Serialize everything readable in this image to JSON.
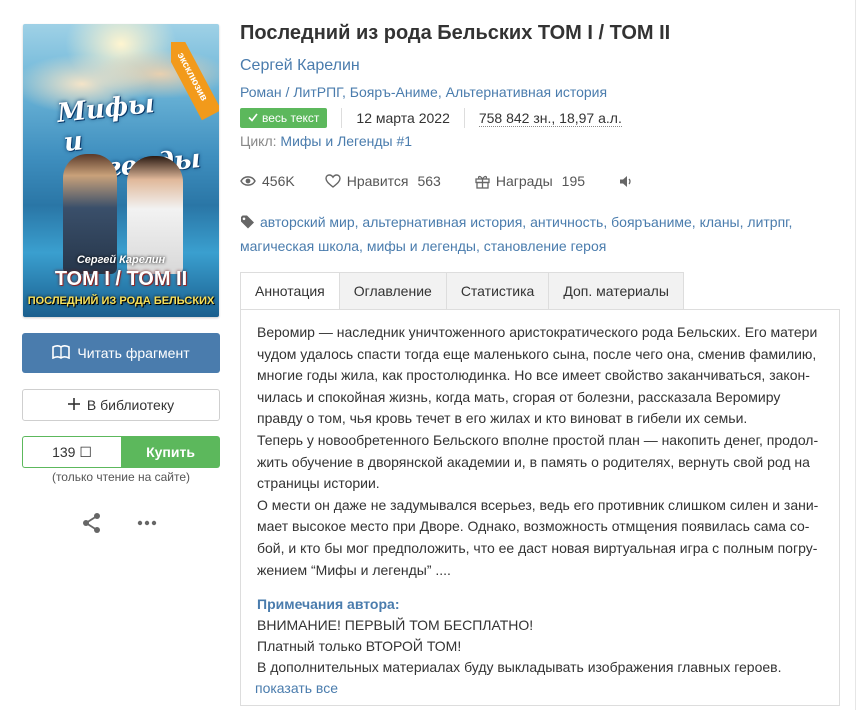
{
  "cover": {
    "title_line1": "Мифы",
    "title_line2": "и Легенды",
    "author": "Сергей Карелин",
    "tom": "ТОМ I / ТОМ II",
    "subtitle": "ПОСЛЕДНИЙ ИЗ РОДА БЕЛЬСКИХ",
    "ribbon": "эксклюзив"
  },
  "left": {
    "read_button": "Читать фрагмент",
    "library_button": "В библиотеку",
    "price": "139 ☐",
    "buy_button": "Купить",
    "buy_note": "(только чтение на сайте)"
  },
  "book": {
    "title": "Последний из рода Бельских ТОМ I / ТОМ II",
    "author": "Сергей Карелин",
    "genres": "Роман / ЛитРПГ, Бояръ-Аниме, Альтернативная история",
    "badge": "весь текст",
    "date": "12 марта 2022",
    "size": "758 842 зн., 18,97 а.л.",
    "cycle_label": "Цикл:",
    "cycle_value": "Мифы и Легенды #1"
  },
  "stats": {
    "views": "456K",
    "likes_label": "Нравится",
    "likes": "563",
    "awards_label": "Награды",
    "awards": "195"
  },
  "tags": "авторский мир, альтернативная история, античность, бояръаниме, кланы, литрпг, магическая школа, мифы и легенды, становление героя",
  "tabs": [
    "Аннотация",
    "Оглавление",
    "Статистика",
    "Доп. материалы"
  ],
  "annotation": [
    "Веромир — наследник уничтоженного аристократического рода Бельских. Его матери чудом удалось спасти тогда еще маленького сына, после чего она, сменив фамилию, многие годы жила, как простолюдинка. Но все имеет свойство заканчиваться, закон-чилась и спокойная жизнь, когда мать, сгорая от болезни, рассказала Веромиру правду о том, чья кровь течет в его жилах и кто виноват в гибели их семьи.",
    "Теперь у новообретенного Бельского вполне простой план — накопить денег, продол-жить обучение в дворянской академии и, в память о родителях, вернуть свой род на страницы истории.",
    "О мести он даже не задумывался всерьез, ведь его противник слишком силен и зани-мает высокое место при Дворе. Однако, возможность отмщения появилась сама со-бой, и кто бы мог предположить, что ее даст новая виртуальная игра с полным погру-жением “Мифы и легенды” ...."
  ],
  "notes": {
    "title": "Примечания автора:",
    "lines": [
      "ВНИМАНИЕ! ПЕРВЫЙ ТОМ БЕСПЛАТНО!",
      "Платный только ВТОРОЙ ТОМ!",
      "В дополнительных материалах буду выкладывать изображения главных героев."
    ],
    "show_all": "показать все"
  },
  "colors": {
    "link": "#4a7cad",
    "green": "#5cb85c",
    "ribbon": "#f29a1b"
  }
}
